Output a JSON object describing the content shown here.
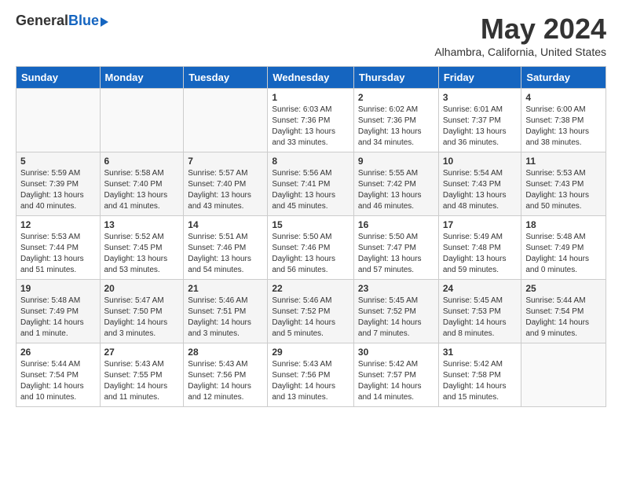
{
  "header": {
    "logo_general": "General",
    "logo_blue": "Blue",
    "month": "May 2024",
    "location": "Alhambra, California, United States"
  },
  "days_of_week": [
    "Sunday",
    "Monday",
    "Tuesday",
    "Wednesday",
    "Thursday",
    "Friday",
    "Saturday"
  ],
  "weeks": [
    [
      {
        "day": "",
        "info": ""
      },
      {
        "day": "",
        "info": ""
      },
      {
        "day": "",
        "info": ""
      },
      {
        "day": "1",
        "info": "Sunrise: 6:03 AM\nSunset: 7:36 PM\nDaylight: 13 hours\nand 33 minutes."
      },
      {
        "day": "2",
        "info": "Sunrise: 6:02 AM\nSunset: 7:36 PM\nDaylight: 13 hours\nand 34 minutes."
      },
      {
        "day": "3",
        "info": "Sunrise: 6:01 AM\nSunset: 7:37 PM\nDaylight: 13 hours\nand 36 minutes."
      },
      {
        "day": "4",
        "info": "Sunrise: 6:00 AM\nSunset: 7:38 PM\nDaylight: 13 hours\nand 38 minutes."
      }
    ],
    [
      {
        "day": "5",
        "info": "Sunrise: 5:59 AM\nSunset: 7:39 PM\nDaylight: 13 hours\nand 40 minutes."
      },
      {
        "day": "6",
        "info": "Sunrise: 5:58 AM\nSunset: 7:40 PM\nDaylight: 13 hours\nand 41 minutes."
      },
      {
        "day": "7",
        "info": "Sunrise: 5:57 AM\nSunset: 7:40 PM\nDaylight: 13 hours\nand 43 minutes."
      },
      {
        "day": "8",
        "info": "Sunrise: 5:56 AM\nSunset: 7:41 PM\nDaylight: 13 hours\nand 45 minutes."
      },
      {
        "day": "9",
        "info": "Sunrise: 5:55 AM\nSunset: 7:42 PM\nDaylight: 13 hours\nand 46 minutes."
      },
      {
        "day": "10",
        "info": "Sunrise: 5:54 AM\nSunset: 7:43 PM\nDaylight: 13 hours\nand 48 minutes."
      },
      {
        "day": "11",
        "info": "Sunrise: 5:53 AM\nSunset: 7:43 PM\nDaylight: 13 hours\nand 50 minutes."
      }
    ],
    [
      {
        "day": "12",
        "info": "Sunrise: 5:53 AM\nSunset: 7:44 PM\nDaylight: 13 hours\nand 51 minutes."
      },
      {
        "day": "13",
        "info": "Sunrise: 5:52 AM\nSunset: 7:45 PM\nDaylight: 13 hours\nand 53 minutes."
      },
      {
        "day": "14",
        "info": "Sunrise: 5:51 AM\nSunset: 7:46 PM\nDaylight: 13 hours\nand 54 minutes."
      },
      {
        "day": "15",
        "info": "Sunrise: 5:50 AM\nSunset: 7:46 PM\nDaylight: 13 hours\nand 56 minutes."
      },
      {
        "day": "16",
        "info": "Sunrise: 5:50 AM\nSunset: 7:47 PM\nDaylight: 13 hours\nand 57 minutes."
      },
      {
        "day": "17",
        "info": "Sunrise: 5:49 AM\nSunset: 7:48 PM\nDaylight: 13 hours\nand 59 minutes."
      },
      {
        "day": "18",
        "info": "Sunrise: 5:48 AM\nSunset: 7:49 PM\nDaylight: 14 hours\nand 0 minutes."
      }
    ],
    [
      {
        "day": "19",
        "info": "Sunrise: 5:48 AM\nSunset: 7:49 PM\nDaylight: 14 hours\nand 1 minute."
      },
      {
        "day": "20",
        "info": "Sunrise: 5:47 AM\nSunset: 7:50 PM\nDaylight: 14 hours\nand 3 minutes."
      },
      {
        "day": "21",
        "info": "Sunrise: 5:46 AM\nSunset: 7:51 PM\nDaylight: 14 hours\nand 3 minutes."
      },
      {
        "day": "22",
        "info": "Sunrise: 5:46 AM\nSunset: 7:52 PM\nDaylight: 14 hours\nand 5 minutes."
      },
      {
        "day": "23",
        "info": "Sunrise: 5:45 AM\nSunset: 7:52 PM\nDaylight: 14 hours\nand 7 minutes."
      },
      {
        "day": "24",
        "info": "Sunrise: 5:45 AM\nSunset: 7:53 PM\nDaylight: 14 hours\nand 8 minutes."
      },
      {
        "day": "25",
        "info": "Sunrise: 5:44 AM\nSunset: 7:54 PM\nDaylight: 14 hours\nand 9 minutes."
      }
    ],
    [
      {
        "day": "26",
        "info": "Sunrise: 5:44 AM\nSunset: 7:54 PM\nDaylight: 14 hours\nand 10 minutes."
      },
      {
        "day": "27",
        "info": "Sunrise: 5:43 AM\nSunset: 7:55 PM\nDaylight: 14 hours\nand 11 minutes."
      },
      {
        "day": "28",
        "info": "Sunrise: 5:43 AM\nSunset: 7:56 PM\nDaylight: 14 hours\nand 12 minutes."
      },
      {
        "day": "29",
        "info": "Sunrise: 5:43 AM\nSunset: 7:56 PM\nDaylight: 14 hours\nand 13 minutes."
      },
      {
        "day": "30",
        "info": "Sunrise: 5:42 AM\nSunset: 7:57 PM\nDaylight: 14 hours\nand 14 minutes."
      },
      {
        "day": "31",
        "info": "Sunrise: 5:42 AM\nSunset: 7:58 PM\nDaylight: 14 hours\nand 15 minutes."
      },
      {
        "day": "",
        "info": ""
      }
    ]
  ]
}
